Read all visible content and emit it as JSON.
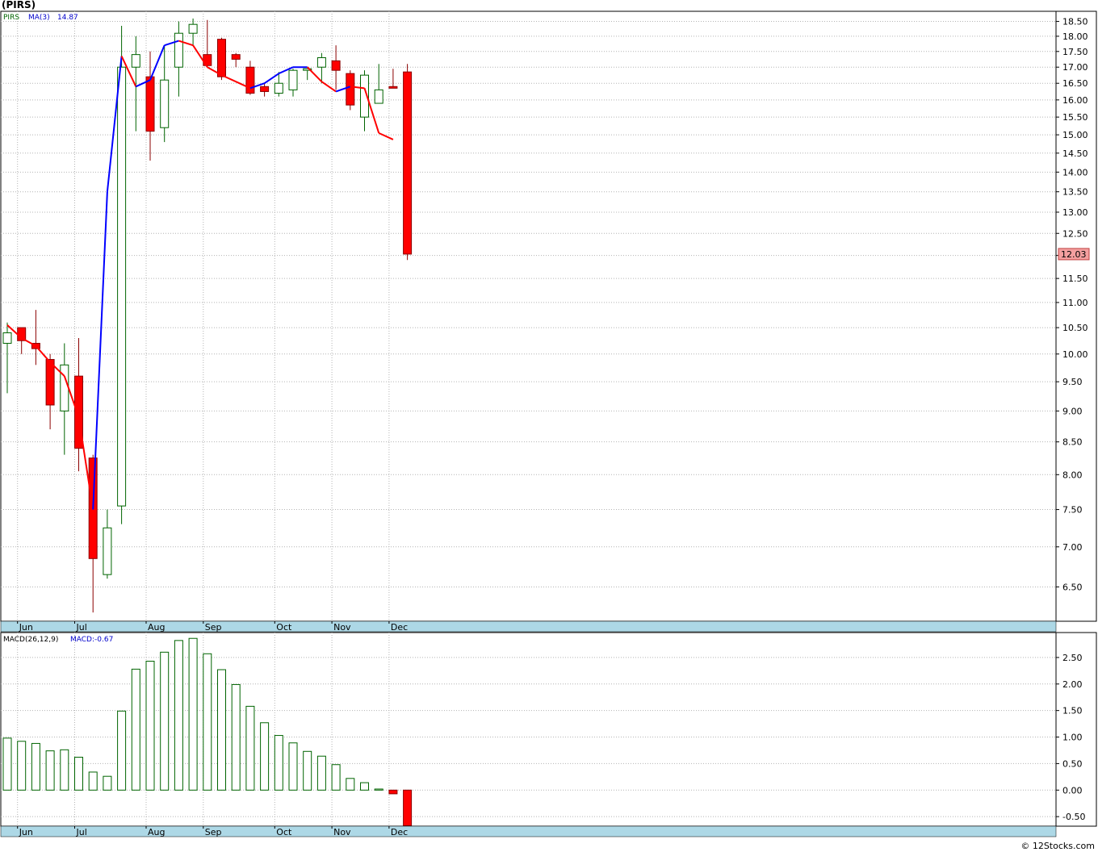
{
  "title": "(PIRS)",
  "footer": "© 12Stocks.com",
  "colors": {
    "grid": "#b4b4b4",
    "axis_bar": "#add8e6",
    "up_candle": "#006400",
    "down_candle": "#ff0000",
    "ma_up": "#0000ff",
    "ma_down": "#ff0000",
    "macd_pos": "#006400",
    "macd_neg": "#ff0000",
    "last_price_bg": "#f4a0a0"
  },
  "chart_data": [
    {
      "type": "candlestick",
      "legend": {
        "symbol": "PIRS",
        "ma_label": "MA(3)",
        "ma_value": "14.87"
      },
      "last_price_label": "12.03",
      "ylim": [
        6.1,
        18.85
      ],
      "y_ticks": [
        "6.50",
        "7.00",
        "7.50",
        "8.00",
        "8.50",
        "9.00",
        "9.50",
        "10.00",
        "10.50",
        "11.00",
        "11.50",
        "12.00",
        "12.50",
        "13.00",
        "13.50",
        "14.00",
        "14.50",
        "15.00",
        "15.50",
        "16.00",
        "16.50",
        "17.00",
        "17.50",
        "18.00",
        "18.50"
      ],
      "x_labels": [
        "Jun",
        "Jul",
        "Aug",
        "Sep",
        "Oct",
        "Nov",
        "Dec"
      ],
      "x_label_index": [
        1,
        5,
        10,
        14,
        19,
        23,
        27
      ],
      "candles": [
        {
          "o": 10.2,
          "h": 10.6,
          "l": 9.3,
          "c": 10.4
        },
        {
          "o": 10.5,
          "h": 10.5,
          "l": 10.0,
          "c": 10.25
        },
        {
          "o": 10.2,
          "h": 10.85,
          "l": 9.8,
          "c": 10.1
        },
        {
          "o": 9.9,
          "h": 10.0,
          "l": 8.7,
          "c": 9.1
        },
        {
          "o": 9.0,
          "h": 10.2,
          "l": 8.3,
          "c": 9.8
        },
        {
          "o": 9.6,
          "h": 10.3,
          "l": 8.05,
          "c": 8.4
        },
        {
          "o": 8.25,
          "h": 8.3,
          "l": 6.2,
          "c": 6.85
        },
        {
          "o": 6.65,
          "h": 7.5,
          "l": 6.6,
          "c": 7.25
        },
        {
          "o": 7.55,
          "h": 18.35,
          "l": 7.3,
          "c": 17.0
        },
        {
          "o": 17.0,
          "h": 18.0,
          "l": 15.1,
          "c": 17.4
        },
        {
          "o": 16.7,
          "h": 17.5,
          "l": 14.3,
          "c": 15.1
        },
        {
          "o": 15.2,
          "h": 17.7,
          "l": 14.8,
          "c": 16.6
        },
        {
          "o": 17.0,
          "h": 18.5,
          "l": 16.1,
          "c": 18.1
        },
        {
          "o": 18.1,
          "h": 18.6,
          "l": 17.7,
          "c": 18.4
        },
        {
          "o": 17.4,
          "h": 18.55,
          "l": 17.0,
          "c": 17.05
        },
        {
          "o": 17.9,
          "h": 17.95,
          "l": 16.6,
          "c": 16.7
        },
        {
          "o": 17.4,
          "h": 17.45,
          "l": 17.0,
          "c": 17.25
        },
        {
          "o": 17.0,
          "h": 17.2,
          "l": 16.15,
          "c": 16.2
        },
        {
          "o": 16.4,
          "h": 16.5,
          "l": 16.1,
          "c": 16.25
        },
        {
          "o": 16.2,
          "h": 16.85,
          "l": 16.1,
          "c": 16.5
        },
        {
          "o": 16.3,
          "h": 16.95,
          "l": 16.1,
          "c": 16.9
        },
        {
          "o": 16.9,
          "h": 16.95,
          "l": 16.6,
          "c": 16.95
        },
        {
          "o": 17.0,
          "h": 17.45,
          "l": 16.5,
          "c": 17.3
        },
        {
          "o": 17.2,
          "h": 17.7,
          "l": 16.3,
          "c": 16.9
        },
        {
          "o": 16.8,
          "h": 16.9,
          "l": 15.7,
          "c": 15.85
        },
        {
          "o": 15.5,
          "h": 16.9,
          "l": 15.1,
          "c": 16.75
        },
        {
          "o": 15.9,
          "h": 17.1,
          "l": 15.9,
          "c": 16.3
        },
        {
          "o": 16.4,
          "h": 16.95,
          "l": 16.35,
          "c": 16.35
        },
        {
          "o": 16.85,
          "h": 17.1,
          "l": 11.9,
          "c": 12.03
        }
      ],
      "ma3": [
        10.55,
        10.3,
        10.15,
        9.85,
        9.6,
        8.9,
        7.5,
        13.5,
        17.35,
        16.4,
        16.6,
        17.7,
        17.85,
        17.7,
        17.0,
        16.75,
        16.55,
        16.35,
        16.5,
        16.8,
        17.0,
        17.0,
        16.55,
        16.25,
        16.4,
        16.35,
        15.05,
        14.87
      ]
    },
    {
      "type": "bar",
      "legend": {
        "name": "MACD(26,12,9)",
        "value_label": "MACD:-0.67"
      },
      "ylim": [
        -0.68,
        2.97
      ],
      "y_ticks": [
        "-0.50",
        "0.00",
        "0.50",
        "1.00",
        "1.50",
        "2.00",
        "2.50"
      ],
      "x_labels": [
        "Jun",
        "Jul",
        "Aug",
        "Sep",
        "Oct",
        "Nov",
        "Dec"
      ],
      "values": [
        0.98,
        0.92,
        0.88,
        0.74,
        0.76,
        0.62,
        0.34,
        0.26,
        1.49,
        2.28,
        2.43,
        2.6,
        2.82,
        2.86,
        2.57,
        2.27,
        1.99,
        1.58,
        1.27,
        1.03,
        0.89,
        0.73,
        0.64,
        0.48,
        0.22,
        0.14,
        0.02,
        -0.07,
        -0.67
      ]
    }
  ]
}
